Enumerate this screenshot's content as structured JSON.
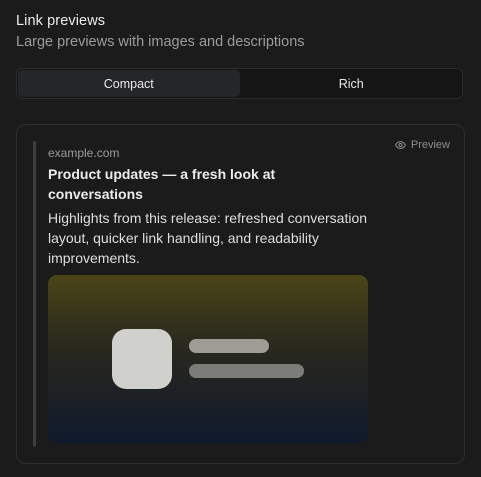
{
  "section": {
    "title": "Link previews",
    "subtitle": "Large previews with images and descriptions"
  },
  "mode_selector": {
    "options": [
      "Compact",
      "Rich"
    ],
    "selected": "Compact"
  },
  "preview_card": {
    "tag_label": "Preview",
    "tag_icon": "eye-icon",
    "domain": "example.com",
    "headline": "Product updates — a fresh look at conversations",
    "description": "Highlights from this release: refreshed conversation layout, quicker link handling, and readability improvements."
  }
}
